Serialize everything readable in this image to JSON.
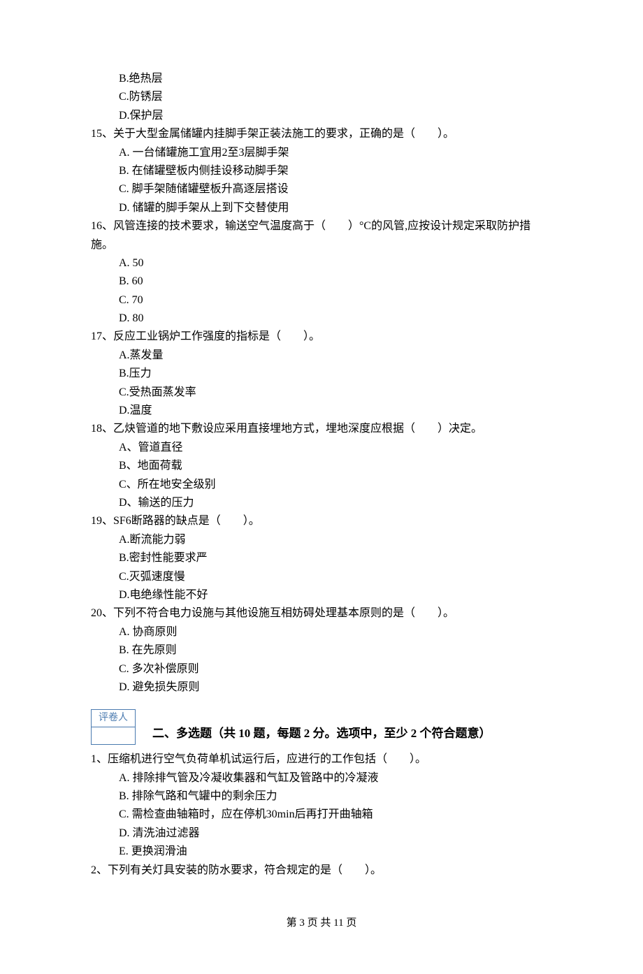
{
  "q14_tail": {
    "b": "B.绝热层",
    "c": "C.防锈层",
    "d": "D.保护层"
  },
  "q15": {
    "stem": "15、关于大型金属储罐内挂脚手架正装法施工的要求，正确的是（　　）。",
    "a": "A. 一台储罐施工宜用2至3层脚手架",
    "b": "B. 在储罐壁板内侧挂设移动脚手架",
    "c": "C. 脚手架随储罐壁板升高逐层搭设",
    "d": "D. 储罐的脚手架从上到下交替使用"
  },
  "q16": {
    "stem1": "16、风管连接的技术要求，输送空气温度高于（　　）°C的风管,应按设计规定采取防护措",
    "stem2": "施。",
    "a": "A. 50",
    "b": "B. 60",
    "c": "C. 70",
    "d": "D. 80"
  },
  "q17": {
    "stem": "17、反应工业锅炉工作强度的指标是（　　）。",
    "a": "A.蒸发量",
    "b": "B.压力",
    "c": "C.受热面蒸发率",
    "d": "D.温度"
  },
  "q18": {
    "stem": "18、乙炔管道的地下敷设应采用直接埋地方式，埋地深度应根据（　　）决定。",
    "a": "A、管道直径",
    "b": "B、地面荷载",
    "c": "C、所在地安全级别",
    "d": "D、输送的压力"
  },
  "q19": {
    "stem": "19、SF6断路器的缺点是（　　）。",
    "a": "A.断流能力弱",
    "b": "B.密封性能要求严",
    "c": "C.灭弧速度慢",
    "d": "D.电绝缘性能不好"
  },
  "q20": {
    "stem": "20、下列不符合电力设施与其他设施互相妨碍处理基本原则的是（　　）。",
    "a": "A. 协商原则",
    "b": "B. 在先原则",
    "c": "C. 多次补偿原则",
    "d": "D. 避免损失原则"
  },
  "grader": "评卷人",
  "section2_title": "二、多选题（共 10 题，每题 2 分。选项中，至少 2 个符合题意）",
  "s2q1": {
    "stem": "1、压缩机进行空气负荷单机试运行后，应进行的工作包括（　　）。",
    "a": "A. 排除排气管及冷凝收集器和气缸及管路中的冷凝液",
    "b": "B. 排除气路和气罐中的剩余压力",
    "c": "C. 需检查曲轴箱时，应在停机30min后再打开曲轴箱",
    "d": "D. 清洗油过滤器",
    "e": "E. 更换润滑油"
  },
  "s2q2": {
    "stem": "2、下列有关灯具安装的防水要求，符合规定的是（　　）。"
  },
  "footer": "第 3 页 共 11 页"
}
